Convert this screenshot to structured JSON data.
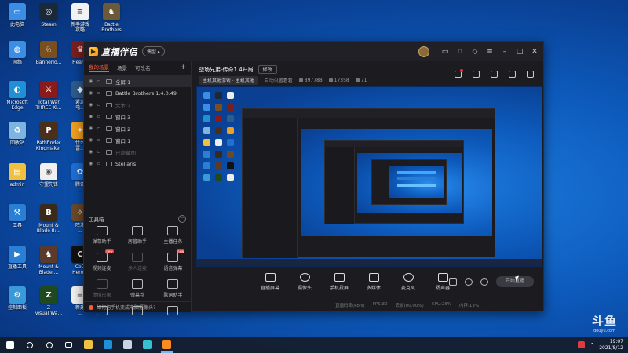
{
  "desktop": {
    "icons": [
      {
        "label": "此电脑",
        "color": "#3a8ee6",
        "glyph": "▭",
        "icon": "computer-icon"
      },
      {
        "label": "Steam",
        "color": "#1b2838",
        "glyph": "◎",
        "icon": "steam-icon"
      },
      {
        "label": "新手游戏\n攻略",
        "color": "#f2f2f2",
        "glyph": "≡",
        "icon": "document-icon"
      },
      {
        "label": "Battle\nBrothers",
        "color": "#6b5a3a",
        "glyph": "♞",
        "icon": "battle-brothers-icon"
      },
      {
        "label": "网络",
        "color": "#3a8ee6",
        "glyph": "◍",
        "icon": "network-icon"
      },
      {
        "label": "Bannerlo...",
        "color": "#7a4f1f",
        "glyph": "♘",
        "icon": "bannerlord-icon"
      },
      {
        "label": "Hearts",
        "color": "#7a1f1f",
        "glyph": "♛",
        "icon": "hearts-of-iron-icon"
      },
      {
        "label": "Microsoft\nEdge",
        "color": "#1f8fd6",
        "glyph": "◐",
        "icon": "edge-icon"
      },
      {
        "label": "Total War\nTHREE KI...",
        "color": "#8b1a1a",
        "glyph": "⚔",
        "icon": "total-war-icon"
      },
      {
        "label": "紧急\n电...",
        "color": "#2e5c8a",
        "glyph": "◆",
        "icon": "app-icon"
      },
      {
        "label": "回收站",
        "color": "#7db4e0",
        "glyph": "♻",
        "icon": "recycle-bin-icon"
      },
      {
        "label": "Pathfinder\nKingmaker",
        "color": "#4a2f1a",
        "glyph": "P",
        "icon": "pathfinder-icon"
      },
      {
        "label": "什么\n雷...",
        "color": "#f0a020",
        "glyph": "✦",
        "icon": "app-icon-2"
      },
      {
        "label": "admin",
        "color": "#f0c040",
        "glyph": "▤",
        "icon": "user-folder-icon"
      },
      {
        "label": "守望先锋",
        "color": "#f0f0f0",
        "glyph": "◉",
        "icon": "overwatch-icon"
      },
      {
        "label": "腾讯\n...",
        "color": "#1f6fd6",
        "glyph": "✿",
        "icon": "tencent-icon"
      },
      {
        "label": "工具",
        "color": "#2a7fd4",
        "glyph": "⚒",
        "icon": "tools-icon"
      },
      {
        "label": "Mount &\nBlade II:...",
        "color": "#3a2a1a",
        "glyph": "B",
        "icon": "mount-blade-icon"
      },
      {
        "label": "阵法\n...",
        "color": "#6a4a2a",
        "glyph": "✧",
        "icon": "app-icon-3"
      },
      {
        "label": "直播工具",
        "color": "#2a7fd4",
        "glyph": "▶",
        "icon": "live-tools-icon"
      },
      {
        "label": "Mount &\nBlade ...",
        "color": "#5a3a2a",
        "glyph": "♞",
        "icon": "mount-blade-warband-icon"
      },
      {
        "label": "CoD\nHero...",
        "color": "#111111",
        "glyph": "C",
        "icon": "cod-icon"
      },
      {
        "label": "控制面板",
        "color": "#3a9ad9",
        "glyph": "⚙",
        "icon": "control-panel-icon"
      },
      {
        "label": "Z\nvisual Wa...",
        "color": "#1f4a1f",
        "glyph": "Z",
        "icon": "z-game-icon"
      },
      {
        "label": "新建\n...",
        "color": "#f2f2f2",
        "glyph": "≡",
        "icon": "new-document-icon"
      }
    ]
  },
  "app": {
    "brand": "直播伴侣",
    "version_pill": "偶型 ▸",
    "left_tabs": [
      "我的场景",
      "场景",
      "可改名"
    ],
    "sources": [
      {
        "label": "全屏 1",
        "dim": false
      },
      {
        "label": "Battle Brothers 1.4.0.49",
        "dim": false
      },
      {
        "label": "文本 2",
        "dim": true
      },
      {
        "label": "窗口 3",
        "dim": false
      },
      {
        "label": "窗口 2",
        "dim": false
      },
      {
        "label": "窗口 1",
        "dim": false
      },
      {
        "label": "已隐藏图",
        "dim": true
      },
      {
        "label": "Stellaris",
        "dim": false
      }
    ],
    "toolbox_title": "工具箱",
    "tools": [
      {
        "label": "弹幕助手",
        "faded": false,
        "new": false
      },
      {
        "label": "房管助手",
        "faded": false,
        "new": false
      },
      {
        "label": "主播任务",
        "faded": false,
        "new": false
      },
      {
        "label": "视频连麦",
        "faded": false,
        "new": true
      },
      {
        "label": "多人连麦",
        "faded": true,
        "new": false
      },
      {
        "label": "语音弹幕",
        "faded": false,
        "new": true
      },
      {
        "label": "虚拟形象",
        "faded": true,
        "new": false
      },
      {
        "label": "弹幕卷",
        "faded": false,
        "new": false
      },
      {
        "label": "歌词助手",
        "faded": false,
        "new": false
      },
      {
        "label": "",
        "faded": false,
        "new": false
      },
      {
        "label": "",
        "faded": false,
        "new": false
      },
      {
        "label": "",
        "faded": false,
        "new": false
      }
    ],
    "tip": "如何把手机变成电脑摄像头?",
    "stream_title": "战场兄弟-传奇1.4开局",
    "edit_label": "修改",
    "category": "主机其他游戏 · 主机其他",
    "stats": [
      {
        "label": "自动设置看看",
        "icon": ""
      },
      {
        "label": "897788",
        "icon": "fans"
      },
      {
        "label": "17358",
        "icon": "heat"
      },
      {
        "label": "71",
        "icon": "viewers"
      }
    ],
    "bottom_tools": [
      {
        "label": "直播屏幕",
        "shape": "screen-icon"
      },
      {
        "label": "摄像头",
        "shape": "camera-icon"
      },
      {
        "label": "手机投屏",
        "shape": "phone-icon"
      },
      {
        "label": "多媒体",
        "shape": "media-icon"
      },
      {
        "label": "麦克风",
        "shape": "mic-icon"
      },
      {
        "label": "扬声器",
        "shape": "speaker-icon"
      }
    ],
    "live_button": "开始直播",
    "status": {
      "bitrate": "直播码率(kb/s)",
      "fps": "FPS:30",
      "drop": "丢帧(00.00%)",
      "cpu": "CPU:26%",
      "mem": "内存:13%"
    }
  },
  "taskbar": {
    "apps": [
      {
        "icon": "start-icon",
        "color": "#ffffff"
      },
      {
        "icon": "search-icon",
        "color": "#ffffff"
      },
      {
        "icon": "cortana-icon",
        "color": "#ffffff"
      },
      {
        "icon": "task-view-icon",
        "color": "#ffffff"
      },
      {
        "icon": "file-explorer-icon",
        "color": "#f0c040"
      },
      {
        "icon": "edge-icon",
        "color": "#1f8fd6"
      },
      {
        "icon": "steam-icon",
        "color": "#c7d5e0"
      },
      {
        "icon": "app-icon",
        "color": "#39c0d0"
      },
      {
        "icon": "livecompanion-icon",
        "color": "#ff8a1f"
      }
    ],
    "time": "19:07",
    "date": "2021/8/12"
  },
  "watermark": {
    "logo": "斗鱼",
    "url": "douyu.com"
  }
}
